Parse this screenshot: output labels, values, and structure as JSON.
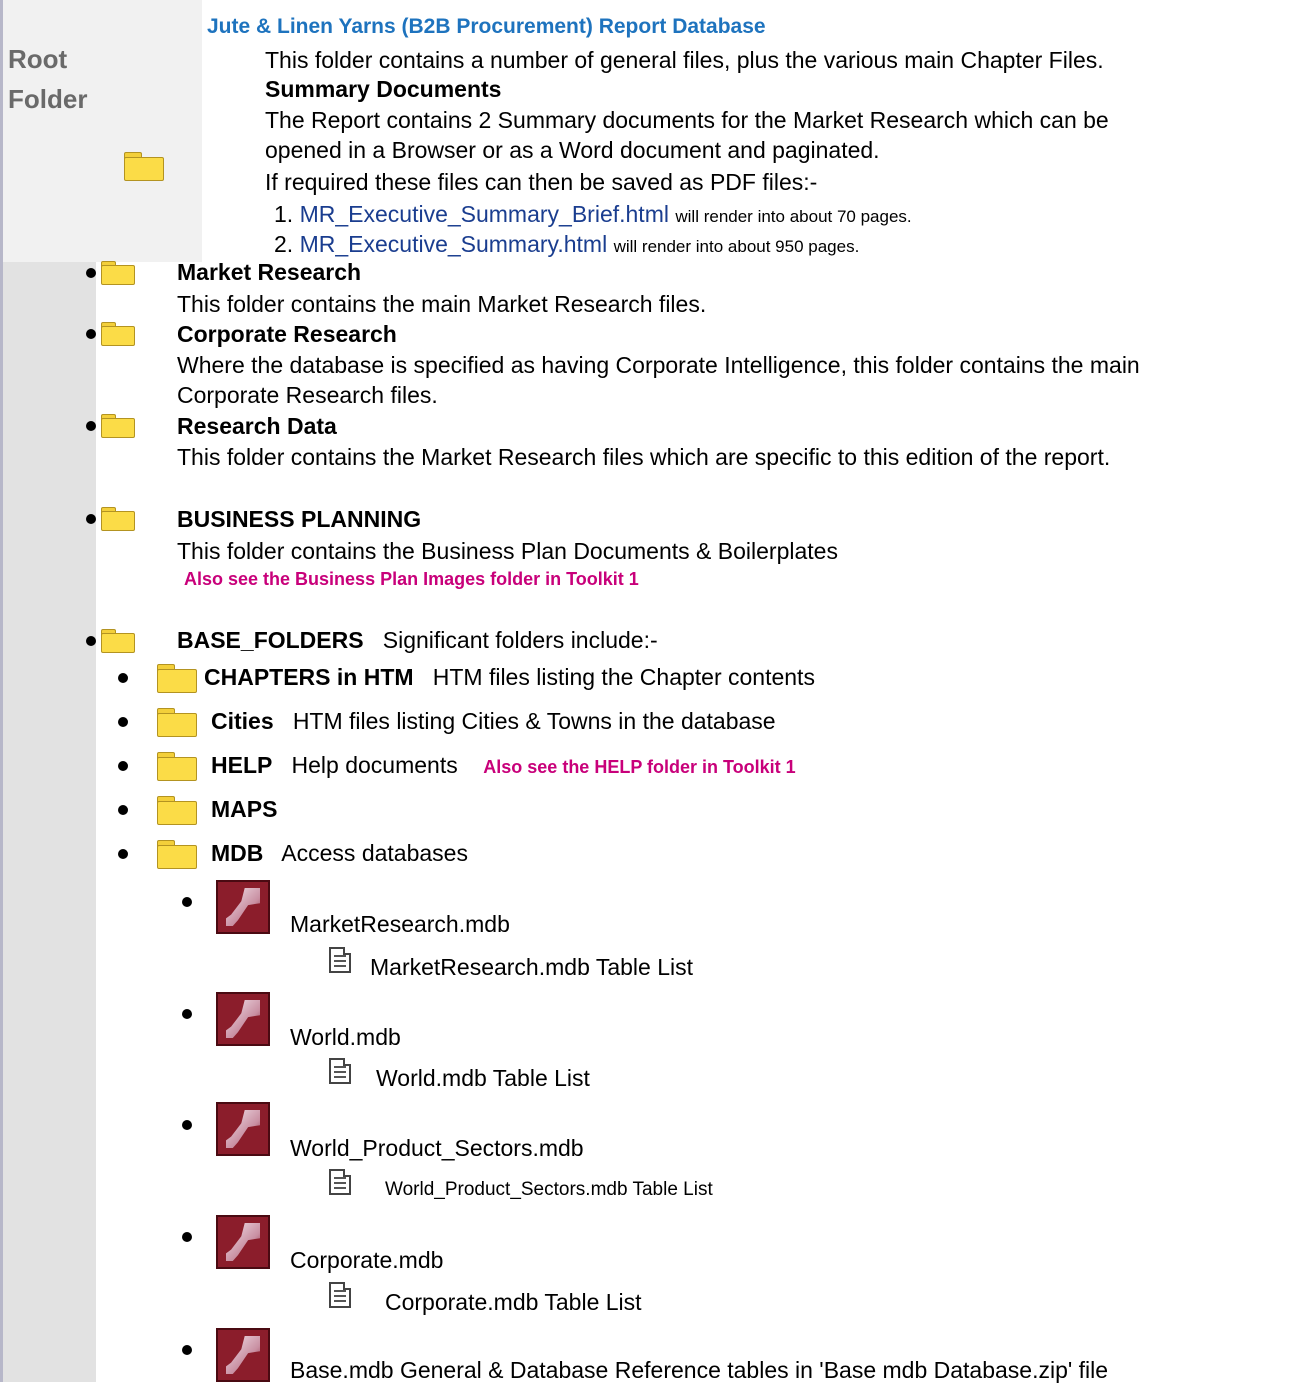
{
  "root": {
    "label_line1": "Root",
    "label_line2": "Folder",
    "title": "Jute & Linen Yarns (B2B Procurement) Report Database",
    "desc": "This folder contains a number of general files, plus the various main Chapter Files.",
    "summary_heading": "Summary Documents",
    "summary_text1": "The Report contains 2 Summary documents for the Market Research which can be",
    "summary_text2": "opened in a Browser or as a Word document and paginated.",
    "summary_text3": "If required these files can then be saved as PDF files:-",
    "files": [
      {
        "num": "1.",
        "link": "MR_Executive_Summary_Brief.html",
        "note": "will render into about 70 pages."
      },
      {
        "num": "2.",
        "link": "MR_Executive_Summary.html",
        "note": "will render into about 950 pages."
      }
    ]
  },
  "folders": [
    {
      "name": "Market Research",
      "desc": "This folder contains the main Market Research files."
    },
    {
      "name": "Corporate Research",
      "desc1": "Where the database is specified as having Corporate Intelligence, this folder contains the main",
      "desc2": "Corporate Research files."
    },
    {
      "name": "Research Data",
      "desc": "This folder contains the Market Research files which are specific to this edition of the report."
    },
    {
      "name": "BUSINESS PLANNING",
      "desc": "This folder contains the Business Plan Documents & Boilerplates",
      "note": "Also see the Business Plan Images folder in Toolkit 1"
    },
    {
      "name": "BASE_FOLDERS",
      "desc": "Significant folders include:-"
    }
  ],
  "base_folders": [
    {
      "name": "CHAPTERS in HTM",
      "desc": "HTM files listing the Chapter contents"
    },
    {
      "name": "Cities",
      "desc": "HTM files listing Cities & Towns in the database"
    },
    {
      "name": "HELP",
      "desc": "Help documents",
      "note": "Also see the HELP folder in Toolkit 1"
    },
    {
      "name": "MAPS",
      "desc": ""
    },
    {
      "name": "MDB",
      "desc": "Access databases"
    }
  ],
  "databases": [
    {
      "name": "MarketResearch.mdb",
      "table_list": "MarketResearch.mdb Table List"
    },
    {
      "name": "World.mdb",
      "table_list": "World.mdb Table List"
    },
    {
      "name": "World_Product_Sectors.mdb",
      "table_list": "World_Product_Sectors.mdb Table List"
    },
    {
      "name": "Corporate.mdb",
      "table_list": "Corporate.mdb Table List"
    },
    {
      "name": "Base.mdb   General & Database Reference tables in 'Base  mdb  Database.zip' file",
      "table_list": ""
    }
  ]
}
